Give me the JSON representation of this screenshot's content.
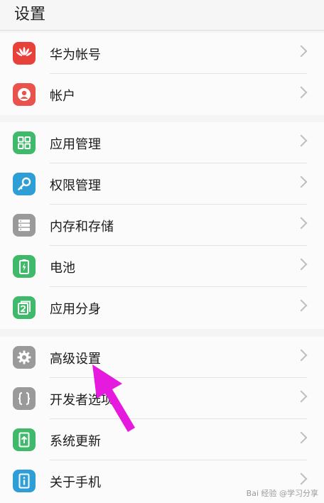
{
  "header": {
    "title": "设置"
  },
  "section1": [
    {
      "label": "华为帐号",
      "icon": "huawei-logo-icon",
      "color": "#e8413a"
    },
    {
      "label": "帐户",
      "icon": "user-account-icon",
      "color": "#e9534b"
    }
  ],
  "section2": [
    {
      "label": "应用管理",
      "icon": "app-grid-icon",
      "color": "#3fba6b"
    },
    {
      "label": "权限管理",
      "icon": "key-icon",
      "color": "#2e9fd6"
    },
    {
      "label": "内存和存储",
      "icon": "storage-icon",
      "color": "#9a9a9a"
    },
    {
      "label": "电池",
      "icon": "battery-icon",
      "color": "#3fba6b"
    },
    {
      "label": "应用分身",
      "icon": "app-twin-icon",
      "color": "#3fba6b"
    }
  ],
  "section3": [
    {
      "label": "高级设置",
      "icon": "gear-icon",
      "color": "#9a9a9a"
    },
    {
      "label": "开发者选项",
      "icon": "braces-icon",
      "color": "#9a9a9a"
    },
    {
      "label": "系统更新",
      "icon": "system-update-icon",
      "color": "#3fba6b"
    },
    {
      "label": "关于手机",
      "icon": "phone-info-icon",
      "color": "#2e9fd6"
    }
  ],
  "annotation": {
    "color": "#e61adf"
  },
  "watermark": "Bai 经验 @学习分享"
}
